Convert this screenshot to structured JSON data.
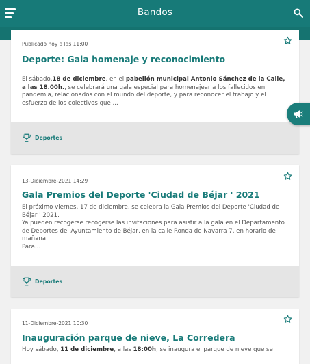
{
  "appbar": {
    "title": "Bandos"
  },
  "icons": {
    "menu": "hamburger-menu-icon",
    "search": "search-icon",
    "favorite": "star-outline-icon",
    "category": "trophy-icon",
    "announcements": "megaphone-icon"
  },
  "colors": {
    "primary": "#177a78",
    "footer": "#e5e5e5",
    "background": "#f1f1f1"
  },
  "cards": [
    {
      "meta": "Publicado hoy a las 11:00",
      "title": "Deporte: Gala homenaje y reconocimiento",
      "body": {
        "p1_a": "El sábado,",
        "p1_b": "18 de diciembre",
        "p1_c": ", en el ",
        "p1_d": "pabellón municipal Antonio Sánchez de la Calle, a las 18.00h.",
        "p1_e": ", se celebrará una gala especial para homenajear a los fallecidos en pandemia, relacionados con el mundo del deporte, y para reconocer el trabajo y el esfuerzo de los colectivos que ..."
      },
      "category": "Deportes"
    },
    {
      "meta": "13-Diciembre-2021 14:29",
      "title": "Gala Premios del Deporte 'Ciudad de Béjar ' 2021",
      "body": {
        "l1": "El próximo viernes, 17 de diciembre, se celebra la Gala Premios del Deporte 'Ciudad de Béjar ' 2021.",
        "l2": "Ya pueden recogerse recogerse las invitaciones para asistir a la gala en el Departamento de Deportes del Ayuntamiento de Béjar, en la calle Ronda de Navarra 7, en horario de mañana.",
        "l3": "Para..."
      },
      "category": "Deportes"
    },
    {
      "meta": "11-Diciembre-2021 10:30",
      "title": "Inauguración parque de nieve, La Corredera",
      "body": {
        "a": "Hoy sábado, ",
        "b": "11 de diciembre",
        "c": ", a las ",
        "d": "18:00h",
        "e": ", se inaugura el parque de nieve que se"
      }
    }
  ]
}
